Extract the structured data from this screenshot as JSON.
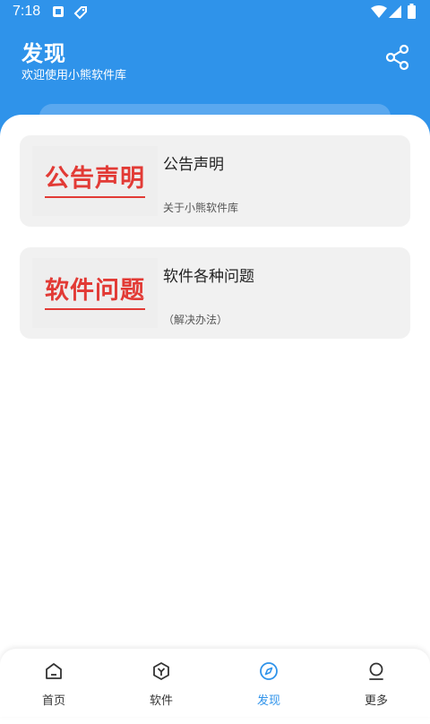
{
  "status_bar": {
    "time": "7:18"
  },
  "header": {
    "title": "发现",
    "subtitle": "欢迎使用小熊软件库",
    "share_icon": "share-icon"
  },
  "colors": {
    "brand_blue": "#2f93ea",
    "card_bg": "#f1f1f1",
    "thumb_red": "#e23a35"
  },
  "cards": [
    {
      "thumb_text": "公告声明",
      "title": "公告声明",
      "description": "关于小熊软件库"
    },
    {
      "thumb_text": "软件问题",
      "title": "软件各种问题",
      "description": "（解决办法）"
    }
  ],
  "bottom_nav": {
    "active": "发现",
    "items": [
      {
        "label": "首页",
        "icon": "home-icon"
      },
      {
        "label": "软件",
        "icon": "apps-icon"
      },
      {
        "label": "发现",
        "icon": "compass-icon"
      },
      {
        "label": "更多",
        "icon": "profile-icon"
      }
    ]
  }
}
